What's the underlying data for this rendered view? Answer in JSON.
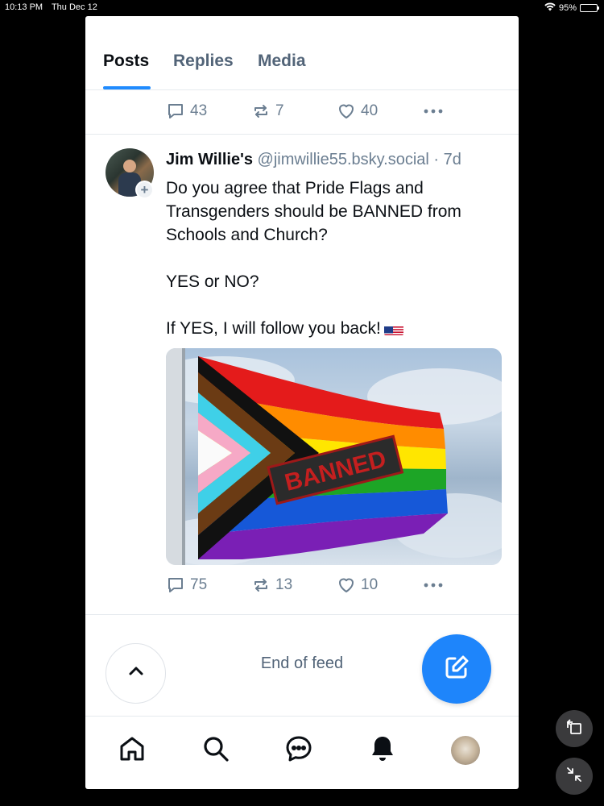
{
  "status_bar": {
    "time": "10:13 PM",
    "date": "Thu Dec 12",
    "battery": "95%",
    "battery_level": 0.95
  },
  "tabs": [
    {
      "label": "Posts",
      "active": true
    },
    {
      "label": "Replies",
      "active": false
    },
    {
      "label": "Media",
      "active": false
    }
  ],
  "previous_post": {
    "replies": "43",
    "reposts": "7",
    "likes": "40"
  },
  "post": {
    "author_name": "Jim Willie's",
    "handle": "@jimwillie55.bsky.social",
    "separator": " · ",
    "time": "7d",
    "text": "Do you agree that Pride Flags and Transgenders should be BANNED from Schools and Church?\n\nYES or NO?\n\nIf YES, I will follow you back!",
    "emoji": "us-flag-emoji",
    "image_caption": "BANNED",
    "replies": "75",
    "reposts": "13",
    "likes": "10"
  },
  "feed": {
    "end_text": "End of feed"
  },
  "nav": {
    "icons": [
      "home-icon",
      "search-icon",
      "chat-icon",
      "bell-icon",
      "profile-avatar"
    ]
  },
  "colors": {
    "accent": "#208bfe",
    "compose_button": "#1e85fb",
    "muted_text": "#6b7e91",
    "divider": "#e6eaee"
  }
}
